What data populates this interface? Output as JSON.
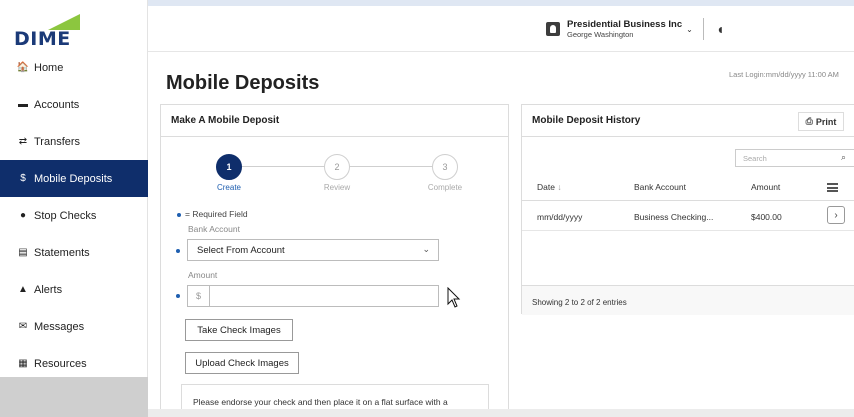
{
  "brand": {
    "logo_text": "DIME",
    "accent": "#8cc63f",
    "navy": "#0f2e6b"
  },
  "sidebar": {
    "items": [
      {
        "label": "Home",
        "icon": "home-icon",
        "glyph": "🏠"
      },
      {
        "label": "Accounts",
        "icon": "folder-icon",
        "glyph": "▬"
      },
      {
        "label": "Transfers",
        "icon": "transfer-arrows-icon",
        "glyph": "⇄"
      },
      {
        "label": "Mobile Deposits",
        "icon": "dollar-icon",
        "glyph": "$",
        "active": true
      },
      {
        "label": "Stop Checks",
        "icon": "stop-icon",
        "glyph": "●"
      },
      {
        "label": "Statements",
        "icon": "document-icon",
        "glyph": "▤"
      },
      {
        "label": "Alerts",
        "icon": "bell-icon",
        "glyph": "▲"
      },
      {
        "label": "Messages",
        "icon": "envelope-icon",
        "glyph": "✉"
      },
      {
        "label": "Resources",
        "icon": "book-icon",
        "glyph": "▦"
      }
    ]
  },
  "header": {
    "business_name": "Presidential Business Inc",
    "user_name": "George Washington"
  },
  "main": {
    "title": "Mobile Deposits",
    "last_login": "Last Login:mm/dd/yyyy 11:00 AM"
  },
  "deposit": {
    "title": "Make A Mobile Deposit",
    "steps": [
      {
        "number": "1",
        "label": "Create",
        "active": true
      },
      {
        "number": "2",
        "label": "Review",
        "active": false
      },
      {
        "number": "3",
        "label": "Complete",
        "active": false
      }
    ],
    "required_note": "= Required Field",
    "bank_account_label": "Bank Account",
    "bank_account_value": "Select From Account",
    "amount_label": "Amount",
    "currency_symbol": "$",
    "amount_value": "",
    "take_images_label": "Take Check Images",
    "upload_images_label": "Upload Check Images",
    "instructions": "Please endorse your check and then place it on a flat surface with a"
  },
  "history": {
    "title": "Mobile Deposit History",
    "print_label": "Print",
    "search_placeholder": "Search",
    "columns": [
      "Date",
      "Bank Account",
      "Amount"
    ],
    "rows": [
      {
        "date": "mm/dd/yyyy",
        "account": "Business Checking...",
        "amount": "$400.00"
      }
    ],
    "footer": "Showing 2 to 2 of 2 entries"
  }
}
